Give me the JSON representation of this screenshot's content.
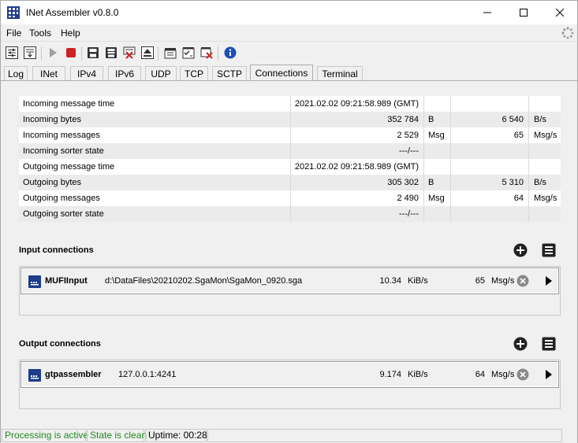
{
  "window": {
    "title": "INet Assembler v0.8.0",
    "controls": {
      "minimize_icon": "minimize-icon",
      "maximize_icon": "maximize-icon",
      "close_icon": "close-icon"
    }
  },
  "menu": {
    "items": [
      {
        "label": "File"
      },
      {
        "label": "Tools"
      },
      {
        "label": "Help"
      }
    ]
  },
  "toolbar": {
    "buttons": [
      "settings-sliders-icon",
      "settings-download-icon",
      "play-icon",
      "stop-icon",
      "save-icon",
      "save-all-icon",
      "delete-icon",
      "eject-icon",
      "clapper-icon",
      "checklist-icon",
      "clear-checklist-icon",
      "info-icon"
    ]
  },
  "tabs": {
    "items": [
      {
        "label": "Log"
      },
      {
        "label": "INet"
      },
      {
        "label": "IPv4"
      },
      {
        "label": "IPv6"
      },
      {
        "label": "UDP"
      },
      {
        "label": "TCP"
      },
      {
        "label": "SCTP"
      },
      {
        "label": "Connections"
      },
      {
        "label": "Terminal"
      }
    ],
    "active": "Connections"
  },
  "stats": {
    "rows": [
      {
        "label": "Incoming message time",
        "value": "2021.02.02 09:21:58.989 (GMT)",
        "unit": "",
        "rate": "",
        "rate_unit": ""
      },
      {
        "label": "Incoming bytes",
        "value": "352 784",
        "unit": "B",
        "rate": "6 540",
        "rate_unit": "B/s"
      },
      {
        "label": "Incoming messages",
        "value": "2 529",
        "unit": "Msg",
        "rate": "65",
        "rate_unit": "Msg/s"
      },
      {
        "label": "Incoming sorter state",
        "value": "---/---",
        "unit": "",
        "rate": "",
        "rate_unit": ""
      },
      {
        "label": "Outgoing message time",
        "value": "2021.02.02 09:21:58.989 (GMT)",
        "unit": "",
        "rate": "",
        "rate_unit": ""
      },
      {
        "label": "Outgoing bytes",
        "value": "305 302",
        "unit": "B",
        "rate": "5 310",
        "rate_unit": "B/s"
      },
      {
        "label": "Outgoing messages",
        "value": "2 490",
        "unit": "Msg",
        "rate": "64",
        "rate_unit": "Msg/s"
      },
      {
        "label": "Outgoing sorter state",
        "value": "---/---",
        "unit": "",
        "rate": "",
        "rate_unit": ""
      }
    ]
  },
  "input_connections": {
    "title": "Input connections",
    "items": [
      {
        "name": "MUFIInput",
        "path": "d:\\DataFiles\\20210202.SgaMon\\SgaMon_0920.sga",
        "speed": "10.34",
        "speed_unit": "KiB/s",
        "rate": "65",
        "rate_unit": "Msg/s"
      }
    ]
  },
  "output_connections": {
    "title": "Output connections",
    "items": [
      {
        "name": "gtpassembler",
        "path": "127.0.0.1:4241",
        "speed": "9.174",
        "speed_unit": "KiB/s",
        "rate": "64",
        "rate_unit": "Msg/s"
      }
    ]
  },
  "status": {
    "processing": "Processing is active",
    "state": "State is clean",
    "uptime": "Uptime: 00:28"
  },
  "colors": {
    "status_green": "#1e8c1e",
    "icon_blue": "#1e3c8c",
    "stop_red": "#cc2222"
  }
}
